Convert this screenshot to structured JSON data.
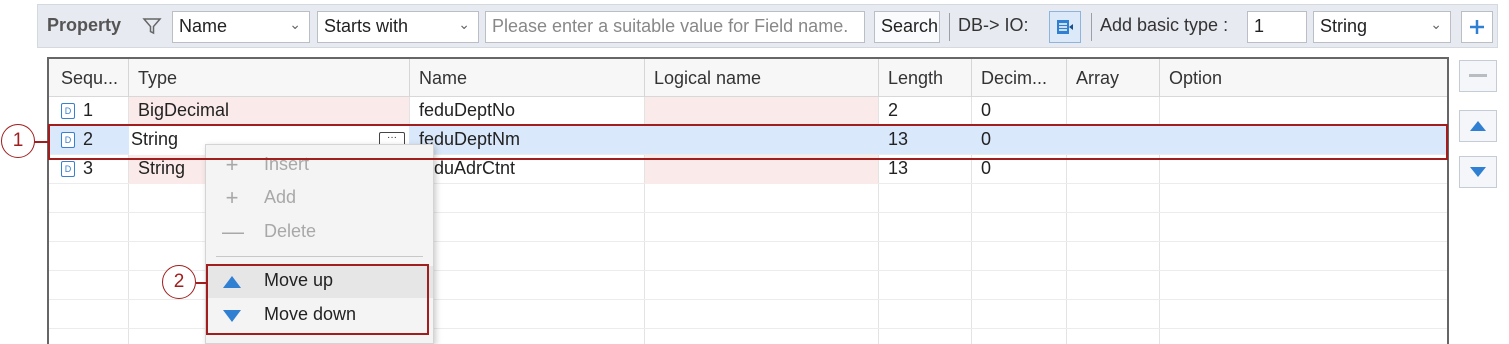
{
  "toolbar": {
    "title": "Property",
    "field_select": "Name",
    "operator_select": "Starts with",
    "search_placeholder": "Please enter a suitable value for Field name.",
    "search_button": "Search",
    "db_io_label": "DB-> IO:",
    "add_basic_type_label": "Add basic type :",
    "count_value": "1",
    "type_select": "String"
  },
  "grid": {
    "columns": [
      "Sequ...",
      "Type",
      "Name",
      "Logical name",
      "Length",
      "Decim...",
      "Array",
      "Option"
    ],
    "rows": [
      {
        "seq": "1",
        "type": "BigDecimal",
        "name": "feduDeptNo",
        "logical": "",
        "length": "2",
        "decimal": "0",
        "array": "",
        "option": ""
      },
      {
        "seq": "2",
        "type": "String",
        "name": "feduDeptNm",
        "logical": "",
        "length": "13",
        "decimal": "0",
        "array": "",
        "option": ""
      },
      {
        "seq": "3",
        "type": "String",
        "name": "feduAdrCtnt",
        "logical": "",
        "length": "13",
        "decimal": "0",
        "array": "",
        "option": ""
      }
    ],
    "row_badge": "D"
  },
  "context_menu": {
    "items": [
      {
        "label": "Insert",
        "icon": "plus-icon",
        "enabled": false
      },
      {
        "label": "Add",
        "icon": "plus-icon",
        "enabled": false
      },
      {
        "label": "Delete",
        "icon": "minus-icon",
        "enabled": false
      },
      {
        "label": "Move up",
        "icon": "triangle-up-icon",
        "enabled": true
      },
      {
        "label": "Move down",
        "icon": "triangle-down-icon",
        "enabled": true
      }
    ]
  },
  "callouts": [
    "1",
    "2"
  ],
  "colors": {
    "accent": "#2f7fd3",
    "annotation": "#a01e1e",
    "selected_row": "#d9e8fb",
    "type_cell_bg": "#fbeaea"
  }
}
